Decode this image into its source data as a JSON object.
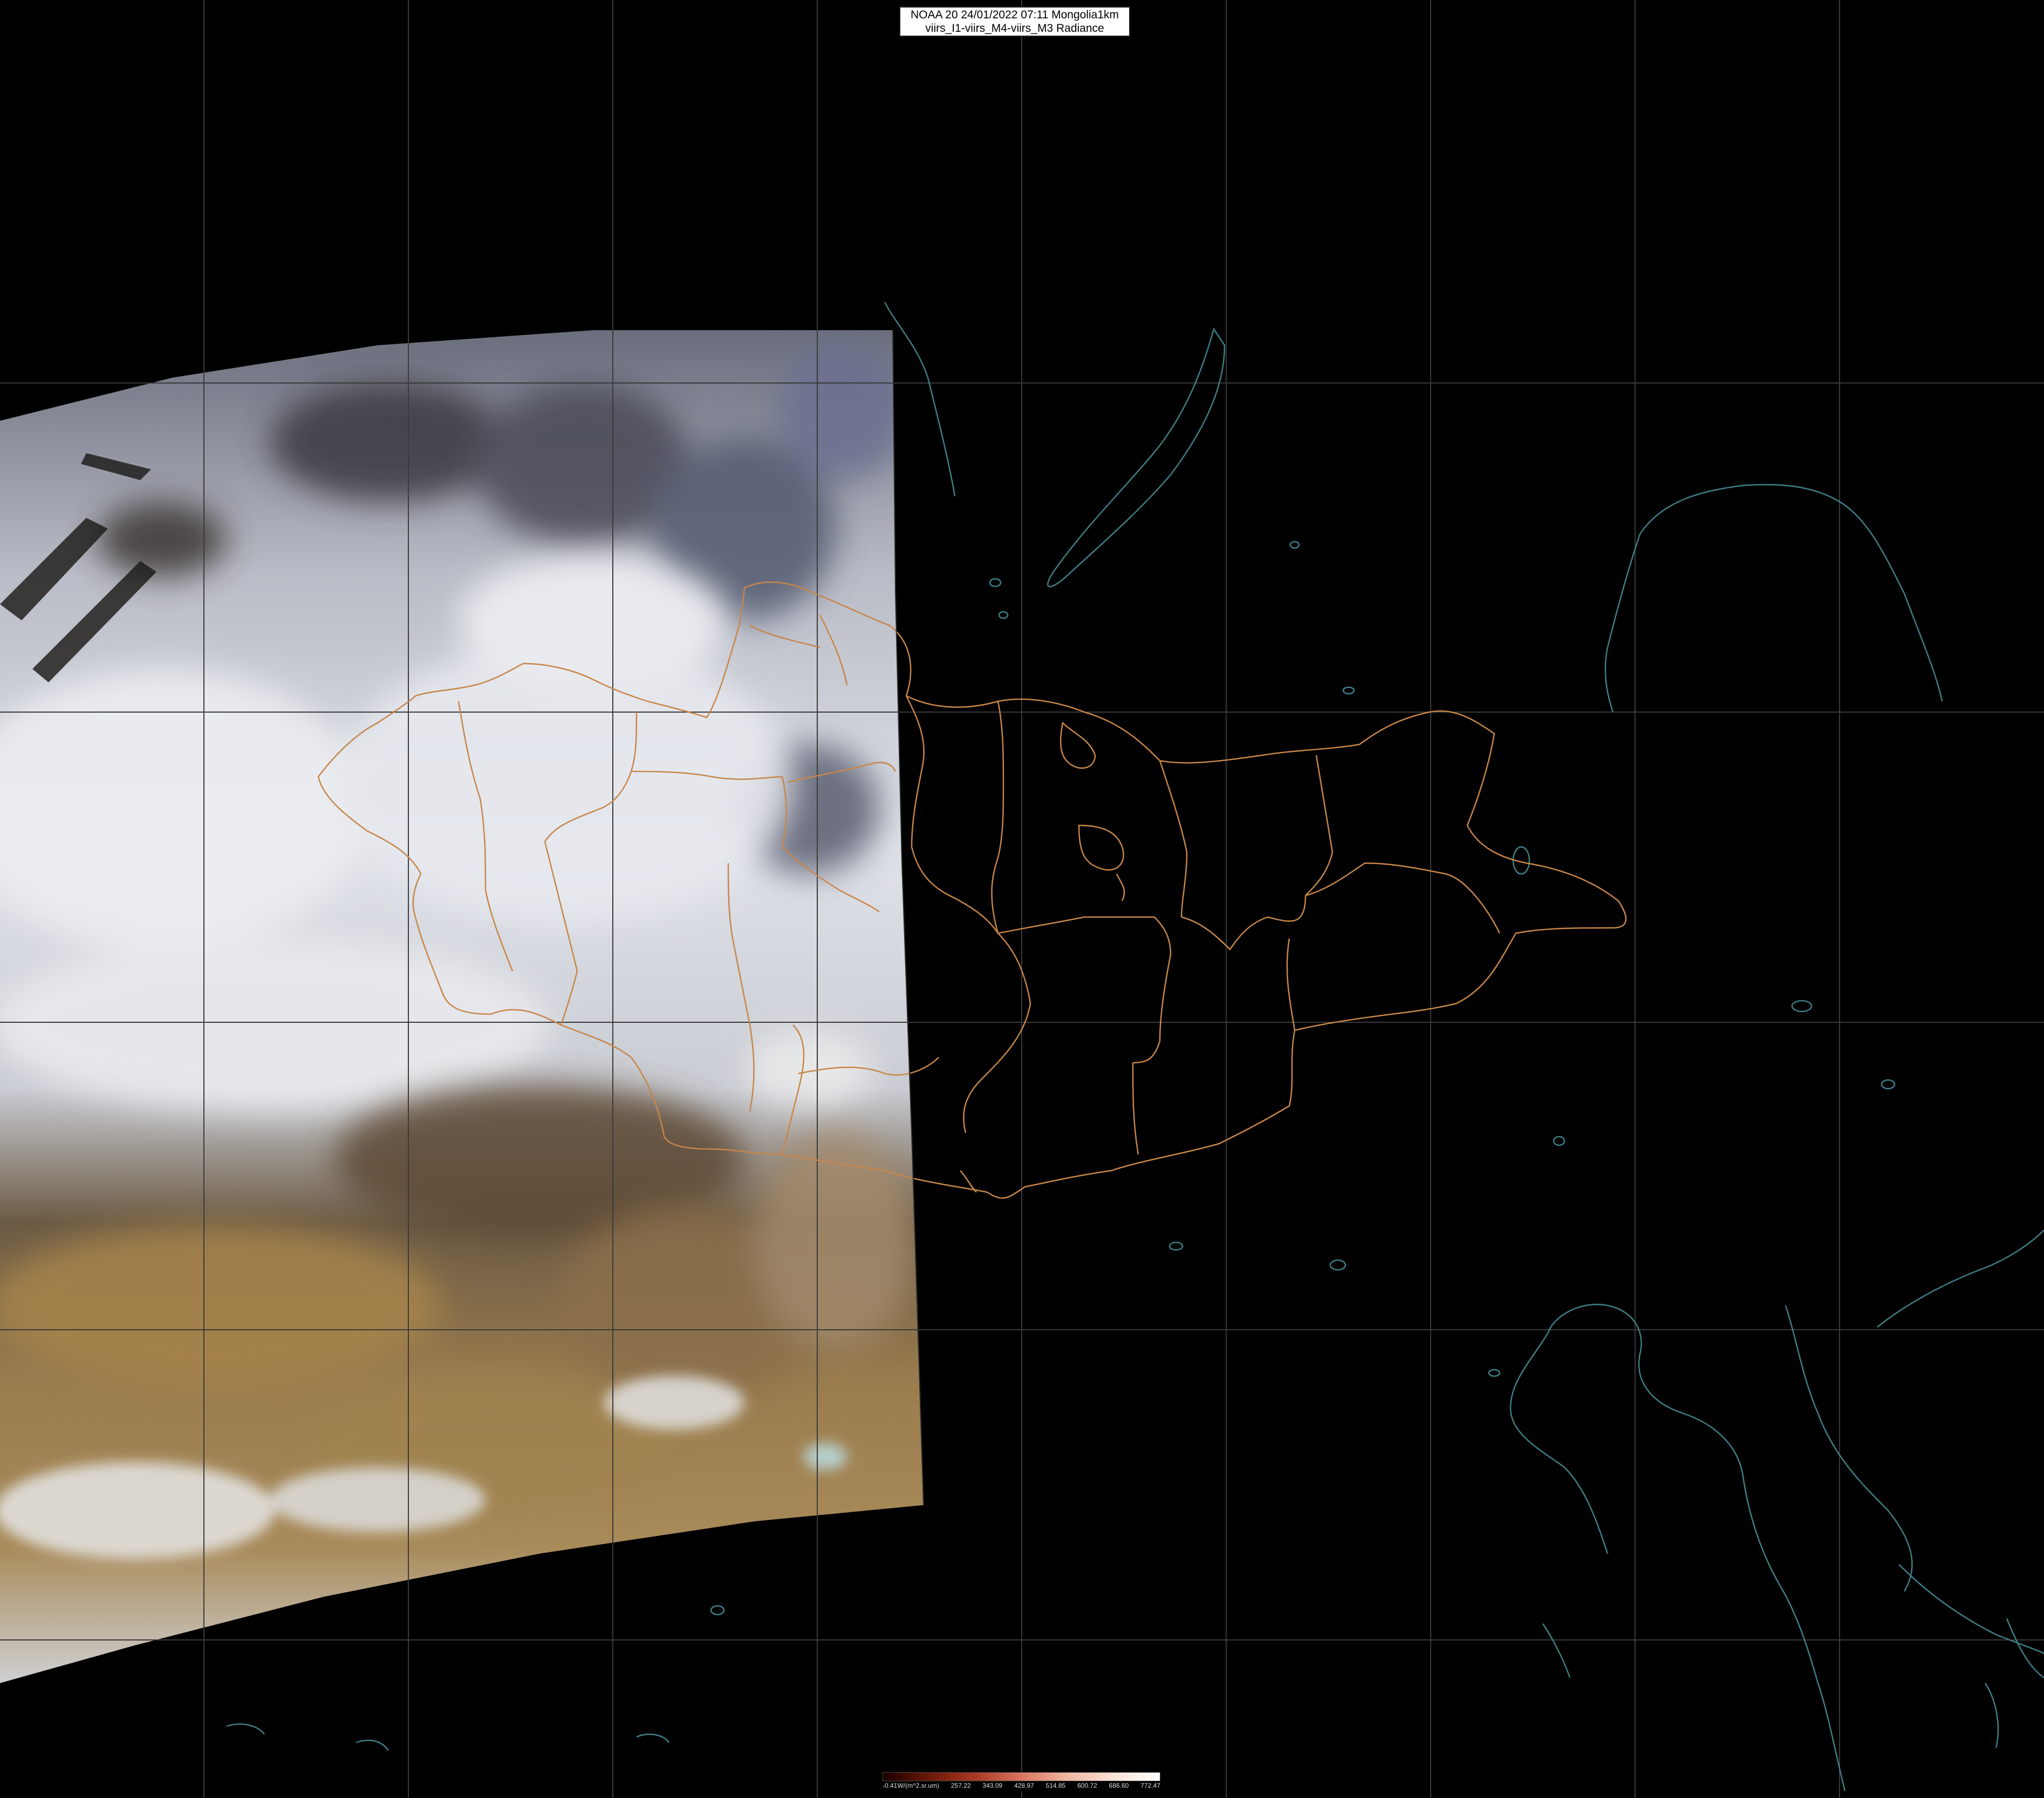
{
  "header": {
    "line1": "NOAA 20 24/01/2022 07:11 Mongolia1km",
    "line2": "viirs_I1-viirs_M4-viirs_M3 Radiance"
  },
  "legend": {
    "unit": "-0.41W/(m^2.sr.um)",
    "ticks": [
      "257.22",
      "343.09",
      "428.97",
      "514.85",
      "600.72",
      "686.60",
      "772.47"
    ]
  },
  "colors": {
    "background": "#000000",
    "border_lines": "#c8864a",
    "coastlines": "#3f7f86",
    "graticule": "#3a3a3a",
    "snow_cloud": "#d8dde6",
    "desert": "#9a7a4c",
    "mountains": "#3a3a44"
  }
}
